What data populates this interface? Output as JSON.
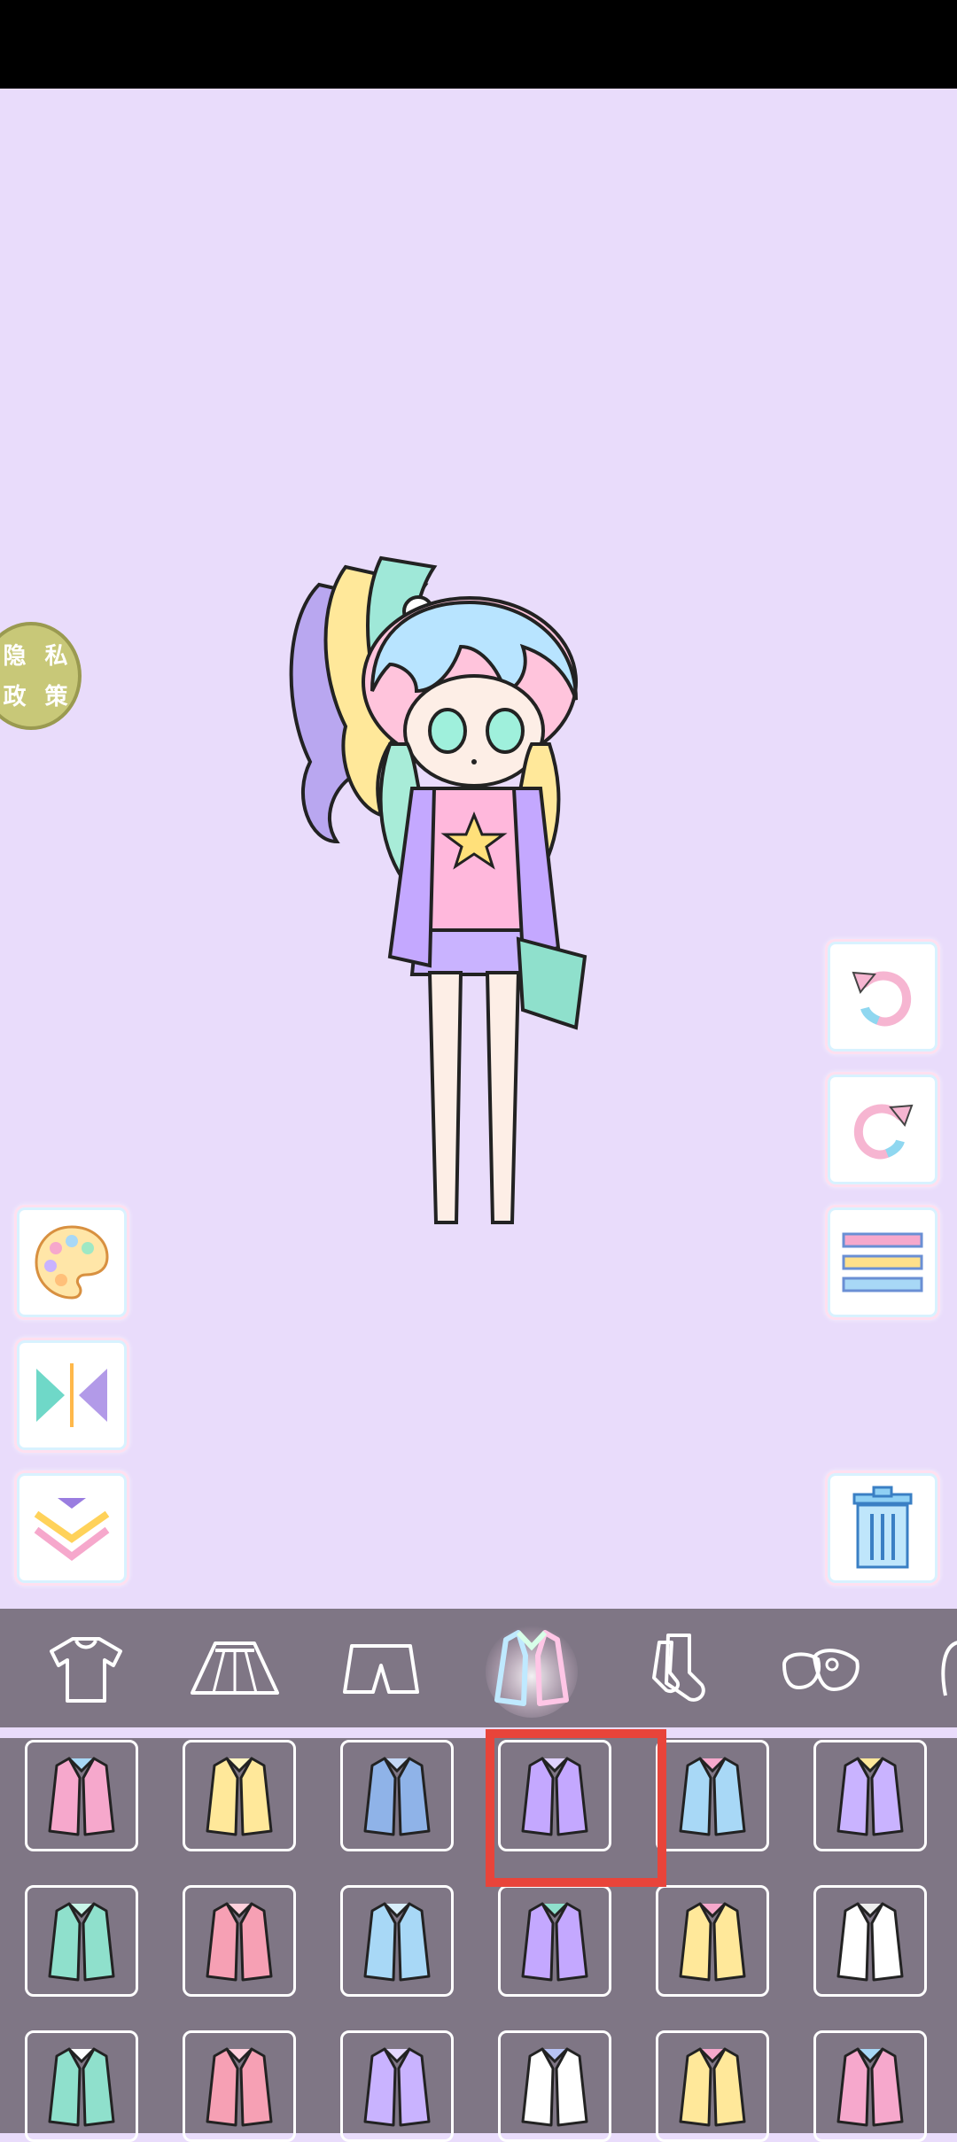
{
  "privacy_button": {
    "line1": "隐 私",
    "line2": "政 策"
  },
  "tools": {
    "left": [
      "palette-icon",
      "mirror-flip-icon",
      "collapse-chevrons-icon"
    ],
    "right": [
      "undo-icon",
      "redo-icon",
      "layers-menu-icon",
      "trash-icon"
    ]
  },
  "category_tabs": [
    "shirt",
    "skirt",
    "shorts",
    "jacket",
    "socks",
    "shoes",
    "more"
  ],
  "selected_tab": "jacket",
  "selected_item_index": 3,
  "items": [
    "pink-wings-star-item",
    "yellow-cardigan",
    "denim-jacket",
    "purple-coat",
    "pastel-windbreaker",
    "purple-yellow-hoodie",
    "mint-coat",
    "pink-duffle-coat",
    "blue-duffle-coat",
    "purple-jacket-with-bag",
    "pink-yellow-hoodie",
    "white-long-coat",
    "varsity-jacket",
    "pink-long-cardigan",
    "purple-sweater",
    "white-sailor-blouse",
    "yellow-top-with-bag",
    "pink-dress"
  ],
  "colors": {
    "background": "#e9dcfb",
    "panel": "#7f7685",
    "selection": "#e8443a"
  }
}
